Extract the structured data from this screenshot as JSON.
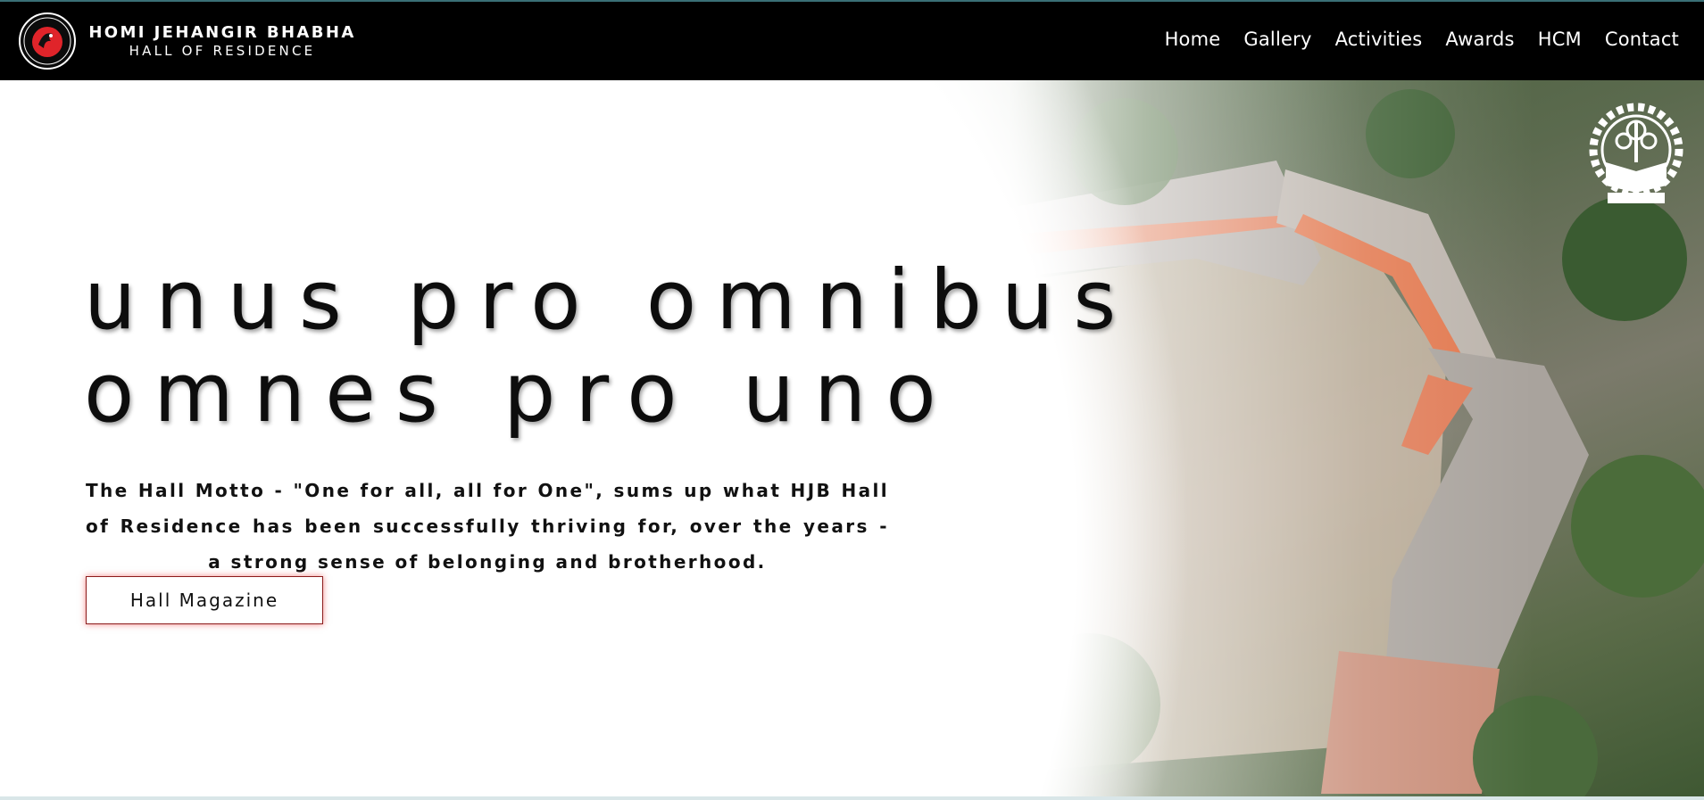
{
  "brand": {
    "title": "HOMI JEHANGIR BHABHA",
    "subtitle": "HALL OF RESIDENCE",
    "logo_icon": "hall-emblem-icon"
  },
  "nav": {
    "items": [
      {
        "label": "Home"
      },
      {
        "label": "Gallery"
      },
      {
        "label": "Activities"
      },
      {
        "label": "Awards"
      },
      {
        "label": "HCM"
      },
      {
        "label": "Contact"
      }
    ]
  },
  "hero": {
    "motto_line1": "unus pro omnibus",
    "motto_line2": "omnes pro uno",
    "description": "The Hall Motto - \"One for all, all for One\", sums up what HJB Hall of Residence has been successfully thriving for, over the years - a strong sense of belonging and brotherhood.",
    "button_label": "Hall Magazine",
    "institute_logo_icon": "iit-kharagpur-emblem-icon"
  },
  "colors": {
    "navbar_bg": "#000000",
    "nav_text": "#ffffff",
    "motto_text": "#0d0d0d",
    "button_border": "#8c1c1c",
    "emblem_red": "#e0242a"
  }
}
